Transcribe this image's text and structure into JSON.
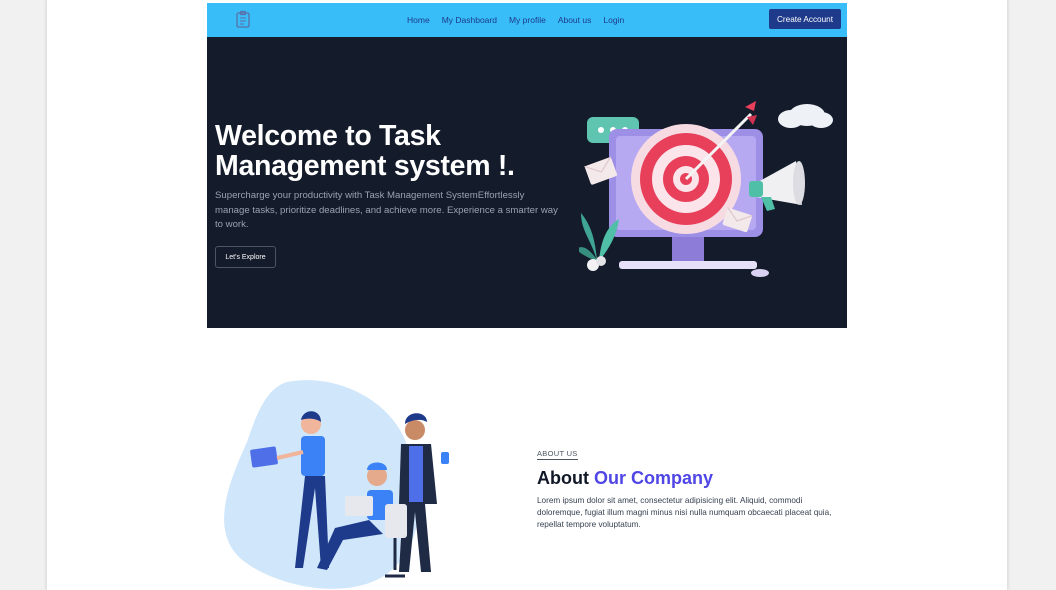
{
  "navbar": {
    "links": [
      "Home",
      "My Dashboard",
      "My profile",
      "About us",
      "Login"
    ],
    "cta_label": "Create Account"
  },
  "hero": {
    "title": "Welcome to Task Management system !.",
    "subtitle": "Supercharge your productivity with Task Management SystemEffortlessly manage tasks, prioritize deadlines, and achieve more. Experience a smarter way to work.",
    "button_label": "Let's Explore"
  },
  "about": {
    "tag": "ABOUT US",
    "title_prefix": "About ",
    "title_highlight": "Our Company",
    "body": "Lorem ipsum dolor sit amet, consectetur adipisicing elit. Aliquid, commodi doloremque, fugiat illum magni minus nisi nulla numquam obcaecati placeat quia, repellat tempore voluptatum."
  },
  "colors": {
    "navbar": "#38bdf8",
    "cta": "#1e3a8a",
    "hero_bg": "#141b2b",
    "accent": "#4f46e5"
  },
  "icons": [
    "logo-icon",
    "target-illustration",
    "team-illustration"
  ]
}
